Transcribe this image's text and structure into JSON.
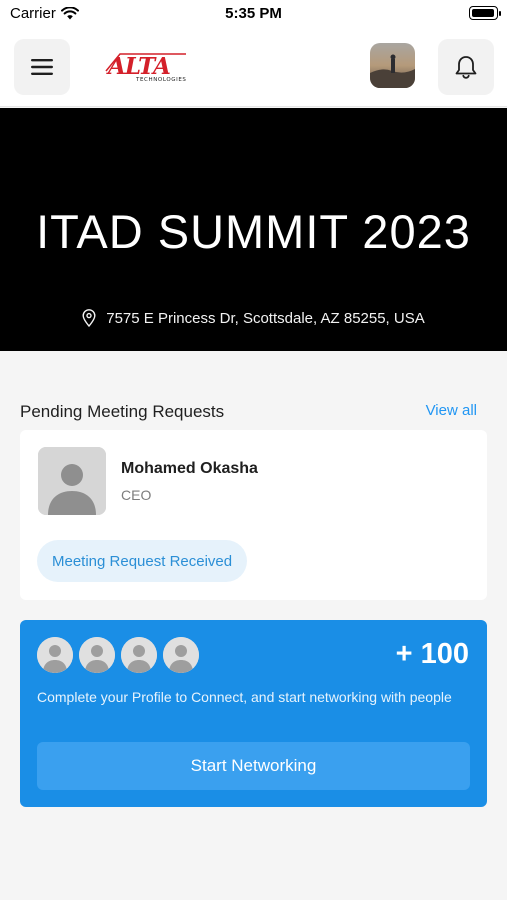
{
  "status_bar": {
    "carrier": "Carrier",
    "time": "5:35 PM"
  },
  "header": {
    "logo": {
      "word": "ALTA",
      "sub": "TECHNOLOGIES"
    },
    "icons": [
      "menu-icon",
      "profile-avatar",
      "bell-icon"
    ]
  },
  "event": {
    "title": "ITAD SUMMIT 2023",
    "location": "7575 E Princess Dr, Scottsdale, AZ 85255, USA"
  },
  "pending": {
    "section_title": "Pending Meeting Requests",
    "view_all": "View all",
    "request": {
      "name": "Mohamed Okasha",
      "role": "CEO",
      "status": "Meeting Request Received"
    }
  },
  "networking": {
    "count": "+ 100",
    "description": "Complete your Profile to Connect, and start networking with people",
    "button": "Start Networking"
  },
  "colors": {
    "accent_blue": "#2196F3",
    "network_card": "#1a8ee6",
    "logo_red": "#d4202a",
    "banner_bg": "#000000"
  }
}
